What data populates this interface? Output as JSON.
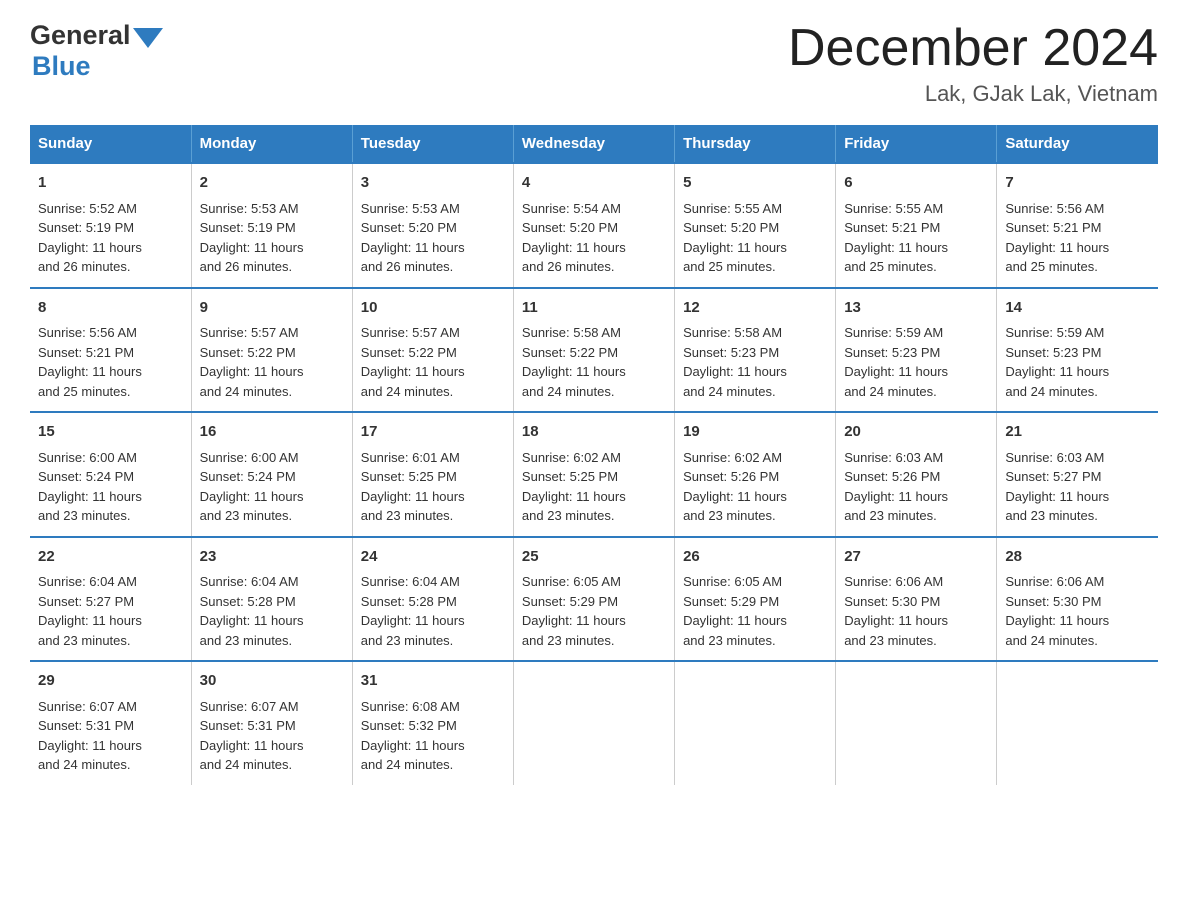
{
  "logo": {
    "text_general": "General",
    "text_blue": "Blue",
    "arrow_color": "#2e7bbf"
  },
  "header": {
    "title": "December 2024",
    "subtitle": "Lak, GJak Lak, Vietnam"
  },
  "weekdays": [
    "Sunday",
    "Monday",
    "Tuesday",
    "Wednesday",
    "Thursday",
    "Friday",
    "Saturday"
  ],
  "weeks": [
    [
      {
        "day": "1",
        "sunrise": "5:52 AM",
        "sunset": "5:19 PM",
        "daylight": "11 hours and 26 minutes."
      },
      {
        "day": "2",
        "sunrise": "5:53 AM",
        "sunset": "5:19 PM",
        "daylight": "11 hours and 26 minutes."
      },
      {
        "day": "3",
        "sunrise": "5:53 AM",
        "sunset": "5:20 PM",
        "daylight": "11 hours and 26 minutes."
      },
      {
        "day": "4",
        "sunrise": "5:54 AM",
        "sunset": "5:20 PM",
        "daylight": "11 hours and 26 minutes."
      },
      {
        "day": "5",
        "sunrise": "5:55 AM",
        "sunset": "5:20 PM",
        "daylight": "11 hours and 25 minutes."
      },
      {
        "day": "6",
        "sunrise": "5:55 AM",
        "sunset": "5:21 PM",
        "daylight": "11 hours and 25 minutes."
      },
      {
        "day": "7",
        "sunrise": "5:56 AM",
        "sunset": "5:21 PM",
        "daylight": "11 hours and 25 minutes."
      }
    ],
    [
      {
        "day": "8",
        "sunrise": "5:56 AM",
        "sunset": "5:21 PM",
        "daylight": "11 hours and 25 minutes."
      },
      {
        "day": "9",
        "sunrise": "5:57 AM",
        "sunset": "5:22 PM",
        "daylight": "11 hours and 24 minutes."
      },
      {
        "day": "10",
        "sunrise": "5:57 AM",
        "sunset": "5:22 PM",
        "daylight": "11 hours and 24 minutes."
      },
      {
        "day": "11",
        "sunrise": "5:58 AM",
        "sunset": "5:22 PM",
        "daylight": "11 hours and 24 minutes."
      },
      {
        "day": "12",
        "sunrise": "5:58 AM",
        "sunset": "5:23 PM",
        "daylight": "11 hours and 24 minutes."
      },
      {
        "day": "13",
        "sunrise": "5:59 AM",
        "sunset": "5:23 PM",
        "daylight": "11 hours and 24 minutes."
      },
      {
        "day": "14",
        "sunrise": "5:59 AM",
        "sunset": "5:23 PM",
        "daylight": "11 hours and 24 minutes."
      }
    ],
    [
      {
        "day": "15",
        "sunrise": "6:00 AM",
        "sunset": "5:24 PM",
        "daylight": "11 hours and 23 minutes."
      },
      {
        "day": "16",
        "sunrise": "6:00 AM",
        "sunset": "5:24 PM",
        "daylight": "11 hours and 23 minutes."
      },
      {
        "day": "17",
        "sunrise": "6:01 AM",
        "sunset": "5:25 PM",
        "daylight": "11 hours and 23 minutes."
      },
      {
        "day": "18",
        "sunrise": "6:02 AM",
        "sunset": "5:25 PM",
        "daylight": "11 hours and 23 minutes."
      },
      {
        "day": "19",
        "sunrise": "6:02 AM",
        "sunset": "5:26 PM",
        "daylight": "11 hours and 23 minutes."
      },
      {
        "day": "20",
        "sunrise": "6:03 AM",
        "sunset": "5:26 PM",
        "daylight": "11 hours and 23 minutes."
      },
      {
        "day": "21",
        "sunrise": "6:03 AM",
        "sunset": "5:27 PM",
        "daylight": "11 hours and 23 minutes."
      }
    ],
    [
      {
        "day": "22",
        "sunrise": "6:04 AM",
        "sunset": "5:27 PM",
        "daylight": "11 hours and 23 minutes."
      },
      {
        "day": "23",
        "sunrise": "6:04 AM",
        "sunset": "5:28 PM",
        "daylight": "11 hours and 23 minutes."
      },
      {
        "day": "24",
        "sunrise": "6:04 AM",
        "sunset": "5:28 PM",
        "daylight": "11 hours and 23 minutes."
      },
      {
        "day": "25",
        "sunrise": "6:05 AM",
        "sunset": "5:29 PM",
        "daylight": "11 hours and 23 minutes."
      },
      {
        "day": "26",
        "sunrise": "6:05 AM",
        "sunset": "5:29 PM",
        "daylight": "11 hours and 23 minutes."
      },
      {
        "day": "27",
        "sunrise": "6:06 AM",
        "sunset": "5:30 PM",
        "daylight": "11 hours and 23 minutes."
      },
      {
        "day": "28",
        "sunrise": "6:06 AM",
        "sunset": "5:30 PM",
        "daylight": "11 hours and 24 minutes."
      }
    ],
    [
      {
        "day": "29",
        "sunrise": "6:07 AM",
        "sunset": "5:31 PM",
        "daylight": "11 hours and 24 minutes."
      },
      {
        "day": "30",
        "sunrise": "6:07 AM",
        "sunset": "5:31 PM",
        "daylight": "11 hours and 24 minutes."
      },
      {
        "day": "31",
        "sunrise": "6:08 AM",
        "sunset": "5:32 PM",
        "daylight": "11 hours and 24 minutes."
      },
      null,
      null,
      null,
      null
    ]
  ]
}
